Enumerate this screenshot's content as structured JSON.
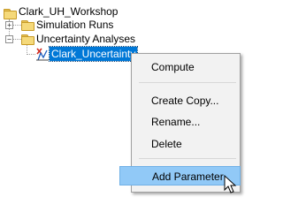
{
  "tree": {
    "root": {
      "label": "Clark_UH_Workshop",
      "icon": "folder-icon"
    },
    "items": [
      {
        "label": "Simulation Runs",
        "icon": "folder-icon",
        "expander": "+"
      },
      {
        "label": "Uncertainty Analyses",
        "icon": "folder-icon",
        "expander": "−"
      },
      {
        "label": "Clark_Uncertainty",
        "icon": "uncertainty-analysis-icon",
        "selected": true
      }
    ]
  },
  "context_menu": {
    "items": [
      {
        "label": "Compute"
      },
      {
        "label": "Create Copy..."
      },
      {
        "label": "Rename..."
      },
      {
        "label": "Delete"
      },
      {
        "label": "Add Parameter",
        "highlighted": true
      }
    ]
  },
  "colors": {
    "selection": "#0078d7",
    "menu_highlight": "#91c9f7",
    "folder": "#f5d97a"
  }
}
